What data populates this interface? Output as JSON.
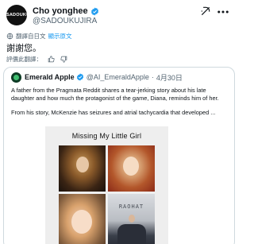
{
  "header": {
    "avatar_text": "SADOUKU",
    "display_name": "Cho yonghee",
    "handle": "@SADOUKUJIRA"
  },
  "translation": {
    "label": "翻譯自日文",
    "show_original": "顯示原文"
  },
  "tweet": {
    "text": "謝謝您。"
  },
  "rating": {
    "label": "評價此翻譯："
  },
  "quote": {
    "display_name": "Emerald Apple",
    "handle": "@AI_EmeraldApple",
    "separator": "·",
    "date": "4月30日",
    "paragraph_1": "A father from the Pragmata Reddit shares a tear-jerking story about his late daughter and how much the protagonist of the game, Diana, reminds him of her.",
    "paragraph_2": "From his story, McKenzie has seizures and atrial tachycardia that developed ...",
    "card": {
      "title": "Missing My Little Girl",
      "photo_caption": "RAOHAT"
    }
  },
  "colors": {
    "accent": "#1d9bf0",
    "verified": "#1d9bf0",
    "secondary_text": "#536471",
    "border": "#cfd9de"
  },
  "icons": [
    "verified-badge-icon",
    "grok-icon",
    "more-icon",
    "globe-icon",
    "thumbs-up-icon",
    "thumbs-down-icon"
  ]
}
